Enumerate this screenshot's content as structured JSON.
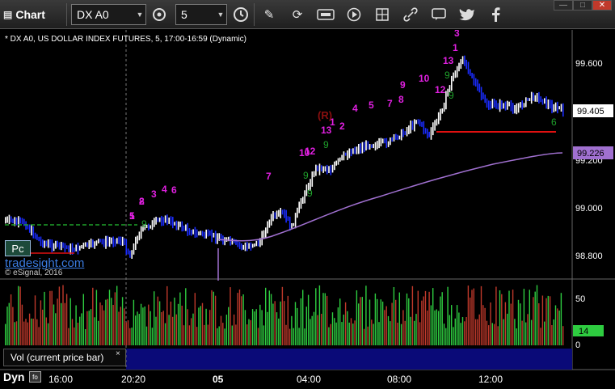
{
  "toolbar": {
    "app_title": "Chart",
    "symbol": "DX A0",
    "interval": "5",
    "icons": [
      "chart-icon",
      "settings-icon",
      "clock-icon",
      "pencil-icon",
      "refresh-icon",
      "get-icon",
      "play-icon",
      "link-icon",
      "message-icon",
      "twitter-icon",
      "facebook-icon"
    ]
  },
  "chart": {
    "title": "* DX A0, US DOLLAR INDEX FUTURES, 5, 17:00-16:59 (Dynamic)",
    "price_ticks": [
      "99.600",
      "99.200",
      "99.000",
      "98.800"
    ],
    "last_price": "99.405",
    "ma_price": "99.226",
    "time_ticks": [
      "16:00",
      "20:20",
      "05",
      "04:00",
      "08:00",
      "12:00"
    ],
    "volume_ticks": [
      "50",
      "0"
    ],
    "volume_last": "14",
    "volume_label": "Vol (current price bar)",
    "volume_close": "×",
    "dyn_label": "Dyn",
    "pc_badge": "Pc",
    "brand": "tradesight.com",
    "copyright": "© eSignal, 2016",
    "annotations": {
      "magenta": [
        "1",
        "2",
        "3",
        "4",
        "6",
        "7",
        "10",
        "12",
        "13",
        "1",
        "2",
        "4",
        "5",
        "7",
        "8",
        "9",
        "10",
        "12",
        "13",
        "1",
        "3",
        "5",
        "8"
      ],
      "dark_red": [
        "(R)"
      ],
      "green": [
        "9",
        "9",
        "9",
        "9",
        "9",
        "9",
        "6"
      ]
    },
    "colors": {
      "up_bar": "#ffffff",
      "down_bar": "#1a2cff",
      "ma_line": "#a070d0",
      "magenta": "#e020e0",
      "green": "#1fa12b",
      "red_line": "#e01010",
      "green_dash": "#1fa12b",
      "vol_up": "#2ecc40",
      "vol_down": "#c0392b",
      "last_price_bg": "#ffffff",
      "ma_bg": "#a070d0",
      "vol_last_bg": "#2ecc40"
    }
  }
}
